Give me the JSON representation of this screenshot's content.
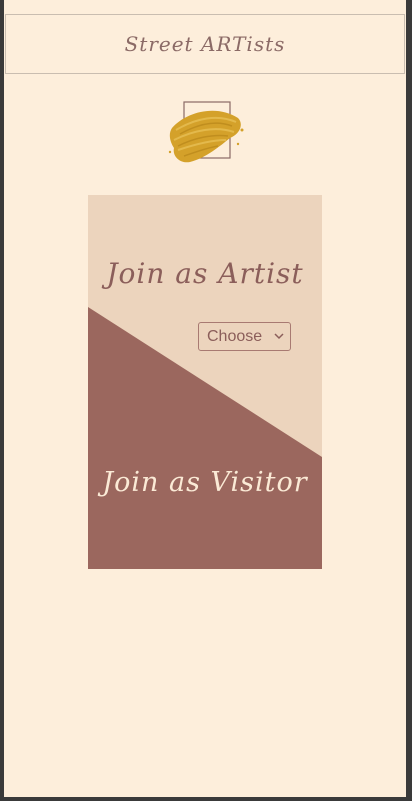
{
  "header": {
    "title": "Street ARTists"
  },
  "logo": {
    "icon": "paint-brush-stroke-logo",
    "color": "#d4a12a"
  },
  "card": {
    "artist_label": "Join as Artist",
    "artist_select": {
      "selected": "Choose",
      "options": [
        "Choose"
      ]
    },
    "visitor_label": "Join as Visitor",
    "colors": {
      "light": "#ecd4bd",
      "dark": "#9b675e"
    }
  }
}
